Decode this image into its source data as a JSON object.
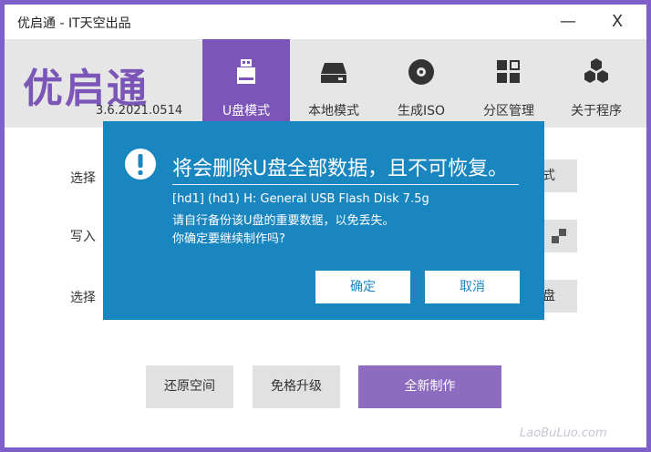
{
  "window": {
    "title": "优启通 - IT天空出品",
    "minimize_icon": "—",
    "close_icon": "X"
  },
  "header": {
    "logo": "优启通",
    "version": "3.6.2021.0514",
    "tabs": [
      {
        "label": "U盘模式",
        "icon": "usb-drive-icon",
        "active": true
      },
      {
        "label": "本地模式",
        "icon": "hard-disk-icon",
        "active": false
      },
      {
        "label": "生成ISO",
        "icon": "disc-icon",
        "active": false
      },
      {
        "label": "分区管理",
        "icon": "partition-grid-icon",
        "active": false
      },
      {
        "label": "关于程序",
        "icon": "hexagon-cluster-icon",
        "active": false
      }
    ]
  },
  "main": {
    "labels": [
      "选择",
      "写入",
      "选择"
    ],
    "right_partials": [
      "式",
      "",
      "盘"
    ],
    "buttons": {
      "restore": "还原空间",
      "upgrade": "免格升级",
      "new_make": "全新制作"
    }
  },
  "dialog": {
    "title": "将会删除U盘全部数据，且不可恢复。",
    "messages": [
      "[hd1] (hd1) H: General USB Flash Disk 7.5g",
      "请自行备份该U盘的重要数据，以免丢失。",
      "你确定要继续制作吗?"
    ],
    "ok": "确定",
    "cancel": "取消"
  },
  "watermark": "LaoBuLuo.com",
  "colors": {
    "accent": "#7b56b8",
    "dialog": "#1a86c0",
    "frame": "#7f5fc9"
  }
}
